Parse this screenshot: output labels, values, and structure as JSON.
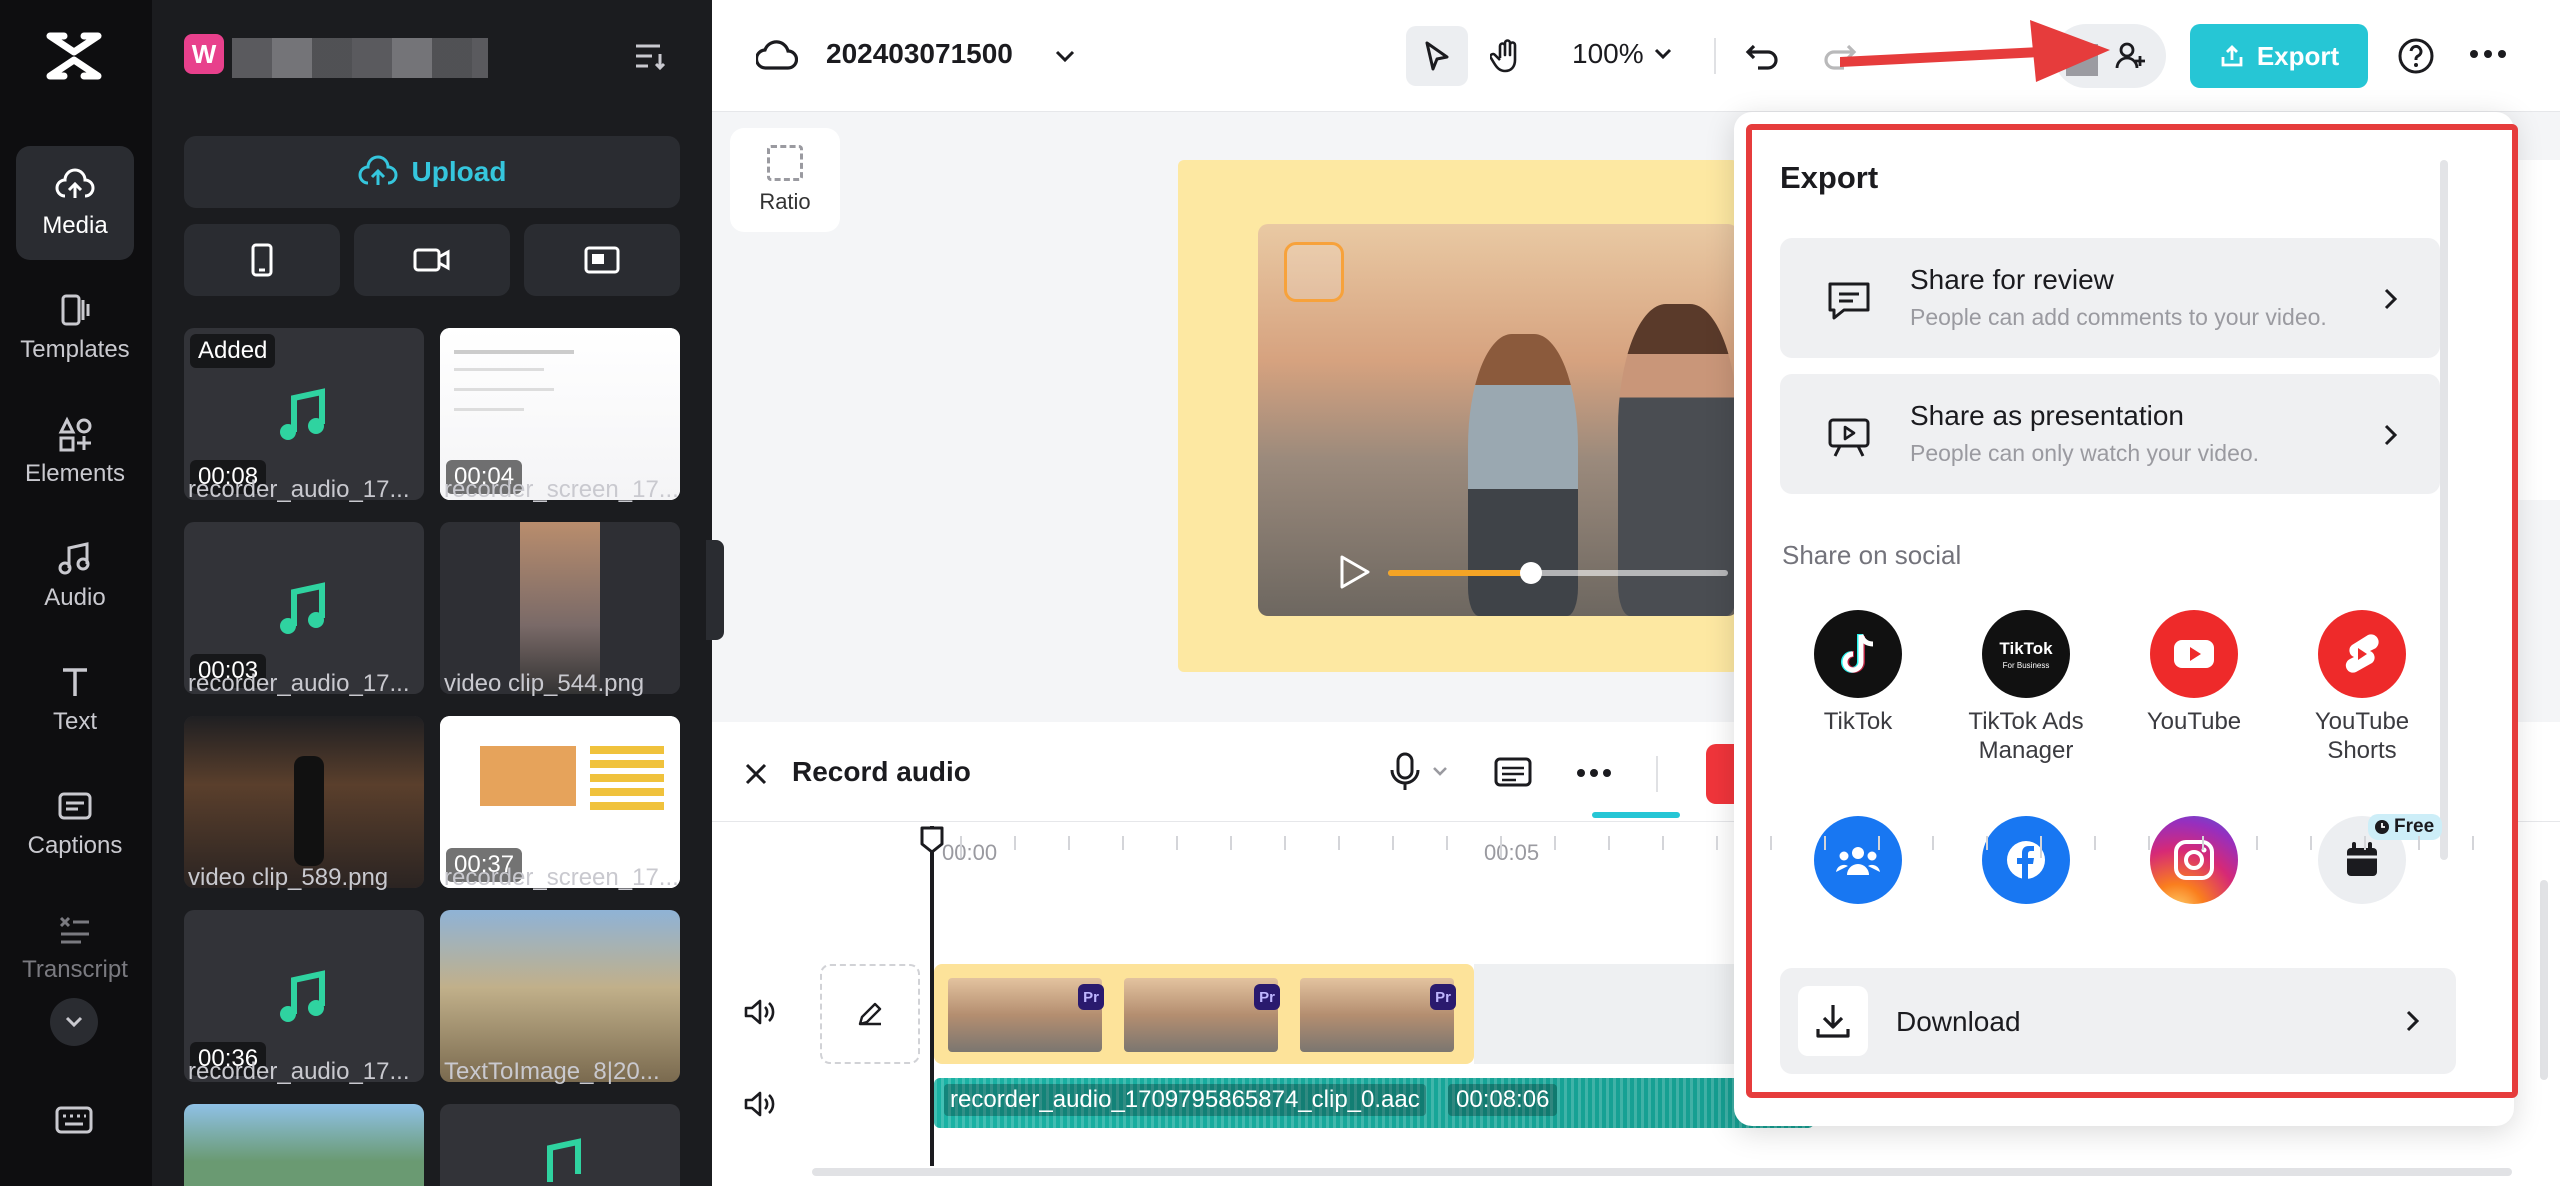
{
  "rail": {
    "items": [
      {
        "label": "Media",
        "icon": "cloud-upload-icon"
      },
      {
        "label": "Templates",
        "icon": "templates-icon"
      },
      {
        "label": "Elements",
        "icon": "elements-icon"
      },
      {
        "label": "Audio",
        "icon": "music-note-icon"
      },
      {
        "label": "Text",
        "icon": "text-icon"
      },
      {
        "label": "Captions",
        "icon": "captions-icon"
      },
      {
        "label": "Transcript",
        "icon": "transcript-icon"
      }
    ]
  },
  "panel": {
    "workspace_initial": "W",
    "upload_label": "Upload",
    "media": [
      {
        "name": "recorder_audio_17...",
        "duration": "00:08",
        "added": "Added",
        "kind": "audio"
      },
      {
        "name": "recorder_screen_17...",
        "duration": "00:04",
        "kind": "screen"
      },
      {
        "name": "recorder_audio_17...",
        "duration": "00:03",
        "kind": "audio"
      },
      {
        "name": "video clip_544.png",
        "duration": "",
        "kind": "image"
      },
      {
        "name": "video clip_589.png",
        "duration": "",
        "kind": "image"
      },
      {
        "name": "recorder_screen_17...",
        "duration": "00:37",
        "kind": "screen"
      },
      {
        "name": "recorder_audio_17...",
        "duration": "00:36",
        "kind": "audio"
      },
      {
        "name": "TextToImage_8|20...",
        "duration": "",
        "kind": "image"
      }
    ]
  },
  "topbar": {
    "project_title": "202403071500",
    "zoom": "100%",
    "export_label": "Export"
  },
  "canvas": {
    "ratio_label": "Ratio",
    "playback_progress": 0.42
  },
  "record": {
    "title": "Record audio"
  },
  "timeline": {
    "ruler": [
      "00:00",
      "00:05"
    ],
    "audio_clip_name": "recorder_audio_1709795865874_clip_0.aac",
    "audio_clip_duration": "00:08:06"
  },
  "export_popup": {
    "title": "Export",
    "share_review": {
      "title": "Share for review",
      "subtitle": "People can add comments to your video."
    },
    "share_presentation": {
      "title": "Share as presentation",
      "subtitle": "People can only watch your video."
    },
    "social_header": "Share on social",
    "social": [
      {
        "label": "TikTok",
        "icon": "tiktok-icon",
        "color": "#111111"
      },
      {
        "label": "TikTok Ads Manager",
        "icon": "tiktok-business-icon",
        "color": "#111111"
      },
      {
        "label": "YouTube",
        "icon": "youtube-icon",
        "color": "#ee2a2a"
      },
      {
        "label": "YouTube Shorts",
        "icon": "youtube-shorts-icon",
        "color": "#ee2a2a"
      },
      {
        "label": "",
        "icon": "facebook-groups-icon",
        "color": "#1877f2"
      },
      {
        "label": "",
        "icon": "facebook-icon",
        "color": "#1877f2"
      },
      {
        "label": "",
        "icon": "instagram-icon",
        "color": "#d62976"
      },
      {
        "label": "",
        "icon": "schedule-icon",
        "color": "#eceef1"
      }
    ],
    "free_badge": "Free",
    "download_label": "Download"
  },
  "colors": {
    "accent": "#26c6d5",
    "annotation": "#e63c3c"
  }
}
